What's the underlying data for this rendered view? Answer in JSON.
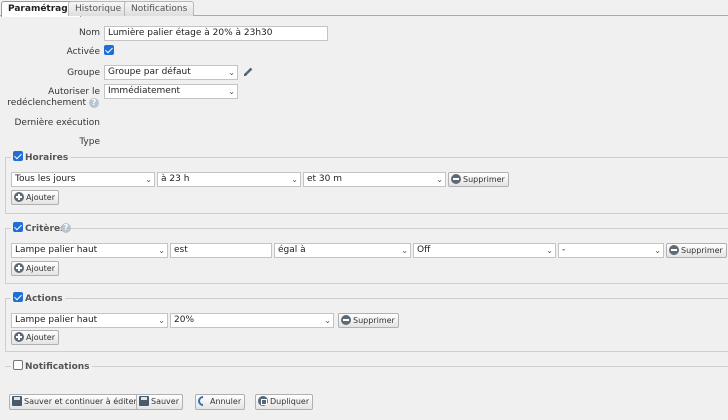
{
  "tabs": [
    {
      "label": "Paramétrage"
    },
    {
      "label": "Historique"
    },
    {
      "label": "Notifications"
    }
  ],
  "form": {
    "name_label": "Nom",
    "name_value": "Lumière palier étage à 20% à 23h30",
    "enabled_label": "Activée",
    "group_label": "Groupe",
    "group_value": "Groupe par défaut",
    "retrigger_label_1": "Autoriser le",
    "retrigger_label_2": "redéclenchement",
    "retrigger_value": "Immédiatement",
    "last_run_label": "Dernière exécution",
    "type_label": "Type"
  },
  "schedules": {
    "title": "Horaires",
    "day": "Tous les jours",
    "hour": "à 23 h",
    "minute": "et 30 m",
    "delete_label": "Supprimer",
    "add_label": "Ajouter"
  },
  "criteria": {
    "title": "Critères",
    "device": "Lampe palier haut",
    "verb": "est",
    "operator": "égal à",
    "value": "Off",
    "extra": "-",
    "delete_label": "Supprimer",
    "add_label": "Ajouter"
  },
  "actions": {
    "title": "Actions",
    "device": "Lampe palier haut",
    "value": "20%",
    "delete_label": "Supprimer",
    "add_label": "Ajouter"
  },
  "notifications": {
    "title": "Notifications"
  },
  "footer": {
    "save_continue_label": "Sauver et continuer à éditer",
    "save_label": "Sauver",
    "cancel_label": "Annuler",
    "duplicate_label": "Dupliquer"
  },
  "icons": {
    "checkbox": "checkbox-checked-icon",
    "help": "help-icon",
    "edit": "pencil-icon",
    "minus": "minus-circle-icon",
    "plus": "plus-circle-icon",
    "save": "floppy-disk-icon",
    "undo": "undo-icon",
    "duplicate": "duplicate-icon"
  },
  "colors": {
    "accent": "#1e6fd9",
    "background": "#f0f0f0"
  }
}
